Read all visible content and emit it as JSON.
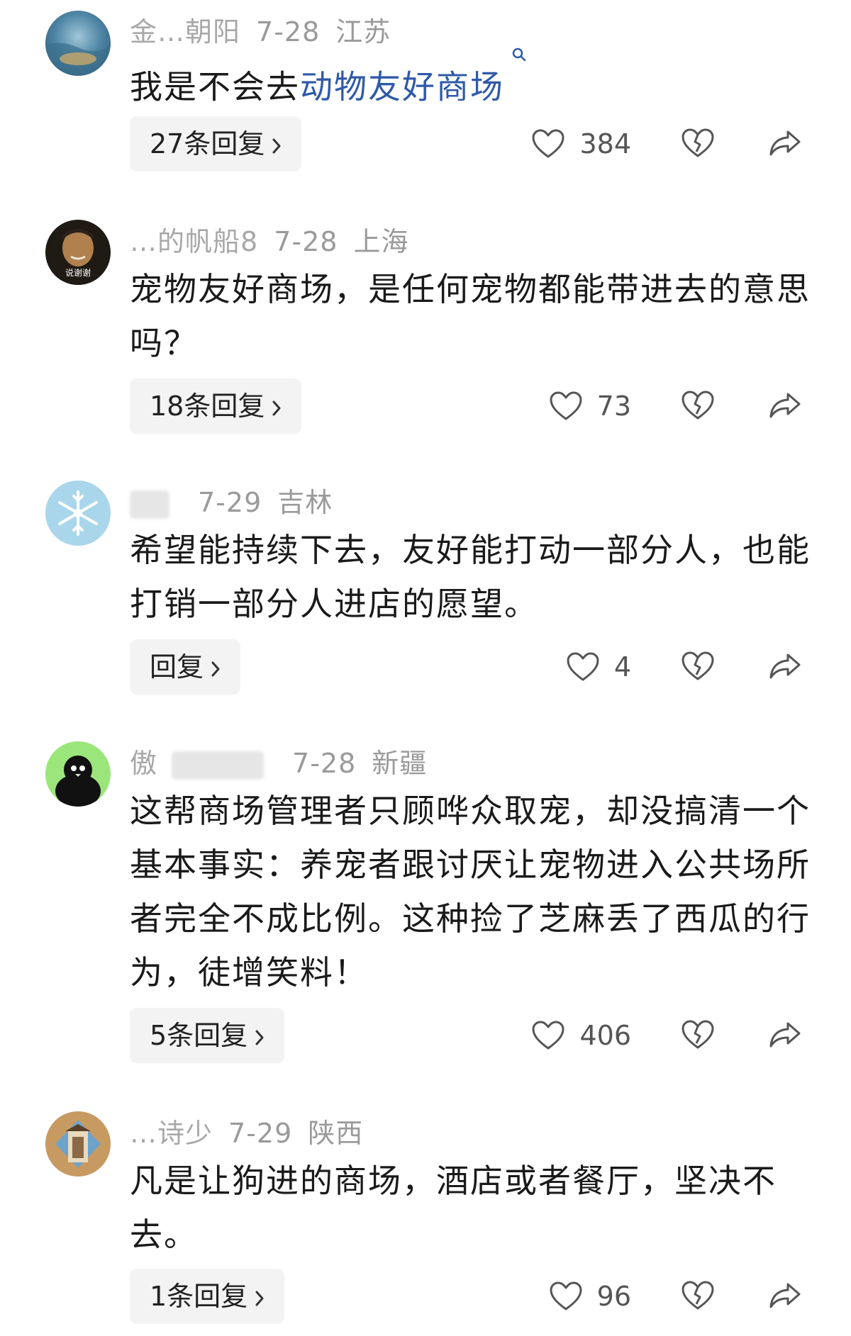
{
  "comments": [
    {
      "name": "金…朝阳",
      "date": "7-28",
      "location": "江苏",
      "text_plain": "我是不会去",
      "text_link": "动物友好商场",
      "replies": "27条回复",
      "likes": "384"
    },
    {
      "name": "…的帆船8",
      "date": "7-28",
      "location": "上海",
      "text": "宠物友好商场，是任何宠物都能带进去的意思吗？",
      "replies": "18条回复",
      "likes": "73",
      "avatar_caption": "说谢谢"
    },
    {
      "name": "",
      "date": "7-29",
      "location": "吉林",
      "text": "希望能持续下去，友好能打动一部分人，也能打销一部分人进店的愿望。",
      "replies": "回复",
      "likes": "4"
    },
    {
      "name": "傲",
      "date": "7-28",
      "location": "新疆",
      "text": "这帮商场管理者只顾哗众取宠，却没搞清一个基本事实：养宠者跟讨厌让宠物进入公共场所者完全不成比例。这种捡了芝麻丢了西瓜的行为，徒增笑料！",
      "replies": "5条回复",
      "likes": "406"
    },
    {
      "name": "…诗少",
      "date": "7-29",
      "location": "陕西",
      "text": "凡是让狗进的商场，酒店或者餐厅，坚决不去。",
      "replies": "1条回复",
      "likes": "96"
    }
  ],
  "icons": {
    "like": "heart-outline-icon",
    "dislike": "broken-heart-icon",
    "share": "share-arrow-icon",
    "chevron": "chevron-right-icon",
    "search": "search-mini-icon"
  },
  "colors": {
    "link": "#2f5aa8",
    "meta": "#9a9a9a",
    "reply_bg": "#f3f3f3"
  }
}
